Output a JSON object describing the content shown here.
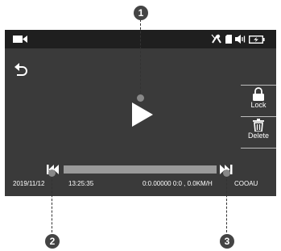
{
  "sidebar": {
    "lock_label": "Lock",
    "delete_label": "Delete"
  },
  "info": {
    "date": "2019/11/12",
    "time": "13:25:35",
    "gps": "0:0.00000 0:0 , 0.0KM/H",
    "brand": "COOAU"
  },
  "callouts": [
    "1",
    "2",
    "3"
  ],
  "icons": [
    "video-camera-icon",
    "gps-off-icon",
    "sd-card-icon",
    "volume-icon",
    "battery-charging-icon",
    "back-icon",
    "play-icon",
    "lock-icon",
    "trash-icon",
    "previous-icon",
    "next-icon"
  ],
  "colors": {
    "screen": "#3a3a3a",
    "statusbar": "#1f1f1f",
    "progress": "#9a9a9a",
    "callout": "#444444"
  }
}
